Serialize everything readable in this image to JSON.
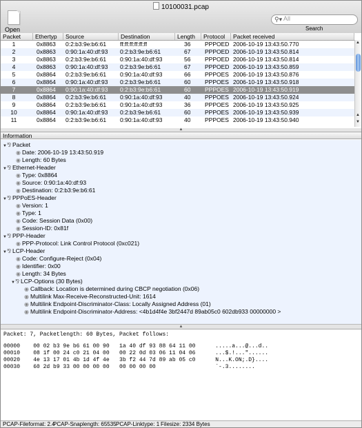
{
  "window": {
    "title": "10100031.pcap"
  },
  "toolbar": {
    "open_label": "Open",
    "search_label": "Search",
    "search_placeholder": "All"
  },
  "table": {
    "columns": [
      "Packet",
      "Ethertyp",
      "Source",
      "Destination",
      "Length",
      "Protocol",
      "Packet received"
    ],
    "rows": [
      [
        "1",
        "0x8863",
        "0:2:b3:9e:b6:61",
        "ff:ff:ff:ff:ff:ff",
        "36",
        "PPPOED",
        "2006-10-19 13:43:50.770"
      ],
      [
        "2",
        "0x8863",
        "0:90:1a:40:df:93",
        "0:2:b3:9e:b6:61",
        "67",
        "PPPOED",
        "2006-10-19 13:43:50.814"
      ],
      [
        "3",
        "0x8863",
        "0:2:b3:9e:b6:61",
        "0:90:1a:40:df:93",
        "56",
        "PPPOED",
        "2006-10-19 13:43:50.814"
      ],
      [
        "4",
        "0x8863",
        "0:90:1a:40:df:93",
        "0:2:b3:9e:b6:61",
        "67",
        "PPPOED",
        "2006-10-19 13:43:50.859"
      ],
      [
        "5",
        "0x8864",
        "0:2:b3:9e:b6:61",
        "0:90:1a:40:df:93",
        "66",
        "PPPOES",
        "2006-10-19 13:43:50.876"
      ],
      [
        "6",
        "0x8864",
        "0:90:1a:40:df:93",
        "0:2:b3:9e:b6:61",
        "60",
        "PPPOES",
        "2006-10-19 13:43:50.918"
      ],
      [
        "7",
        "0x8864",
        "0:90:1a:40:df:93",
        "0:2:b3:9e:b6:61",
        "60",
        "PPPOES",
        "2006-10-19 13:43:50.919"
      ],
      [
        "8",
        "0x8864",
        "0:2:b3:9e:b6:61",
        "0:90:1a:40:df:93",
        "40",
        "PPPOES",
        "2006-10-19 13:43:50.924"
      ],
      [
        "9",
        "0x8864",
        "0:2:b3:9e:b6:61",
        "0:90:1a:40:df:93",
        "36",
        "PPPOES",
        "2006-10-19 13:43:50.925"
      ],
      [
        "10",
        "0x8864",
        "0:90:1a:40:df:93",
        "0:2:b3:9e:b6:61",
        "60",
        "PPPOES",
        "2006-10-19 13:43:50.939"
      ],
      [
        "11",
        "0x8864",
        "0:2:b3:9e:b6:61",
        "0:90:1a:40:df:93",
        "40",
        "PPPOES",
        "2006-10-19 13:43:50.940"
      ]
    ],
    "selected_packet": "7"
  },
  "info": {
    "header": "Information",
    "packet": {
      "label": "Packet",
      "date": "Date: 2006-10-19 13:43:50.919",
      "length": "Length: 60 Bytes"
    },
    "ethernet": {
      "label": "Ethernet-Header",
      "type": "Type: 0x8864",
      "source": "Source: 0:90:1a:40:df:93",
      "destination": "Destination: 0:2:b3:9e:b6:61"
    },
    "pppoes": {
      "label": "PPPoES-Header",
      "version": "Version: 1",
      "type": "Type: 1",
      "code": "Code: Session Data (0x00)",
      "session": "Session-ID: 0x81f"
    },
    "ppp": {
      "label": "PPP-Header",
      "protocol": "PPP-Protocol: Link Control Protocol (0xc021)"
    },
    "lcp": {
      "label": "LCP-Header",
      "code": "Code: Configure-Reject (0x04)",
      "identifier": "Identifier: 0x00",
      "length": "Length: 34 Bytes",
      "options_label": "LCP-Options (30 Bytes)",
      "options": [
        "Callback: Location is determined during CBCP negotiation (0x06)",
        "Multilink Max-Receive-Reconstructed-Unit: 1614",
        "Multilink Endpoint-Discriminator-Class: Locally Assigned Address (01)",
        "Multilink Endpoint-Discriminator-Address: <4b1d4f4e 3bf2447d 89ab05c0 602db933 00000000 >"
      ]
    }
  },
  "hex": {
    "summary": "Packet: 7, Packetlength: 60 Bytes, Packet follows:",
    "lines": [
      "00000    00 02 b3 9e b6 61 00 90   1a 40 df 93 88 64 11 00      .....a...@...d..",
      "00010    08 1f 00 24 c0 21 04 00   00 22 0d 03 06 11 04 06      ...$.!...\"......",
      "00020    4e 13 17 01 4b 1d 4f 4e   3b f2 44 7d 89 ab 05 c0      N...K.ON;.D}....",
      "00030    60 2d b9 33 00 00 00 00   00 00 00 00                  `-.3........"
    ]
  },
  "status": {
    "fileformat": "PCAP-Fileformat: 2.4",
    "snaplength": "PCAP-Snaplength: 65535",
    "linktype": "PCAP-Linktype: 1",
    "filesize": "Filesize: 2334 Bytes"
  }
}
